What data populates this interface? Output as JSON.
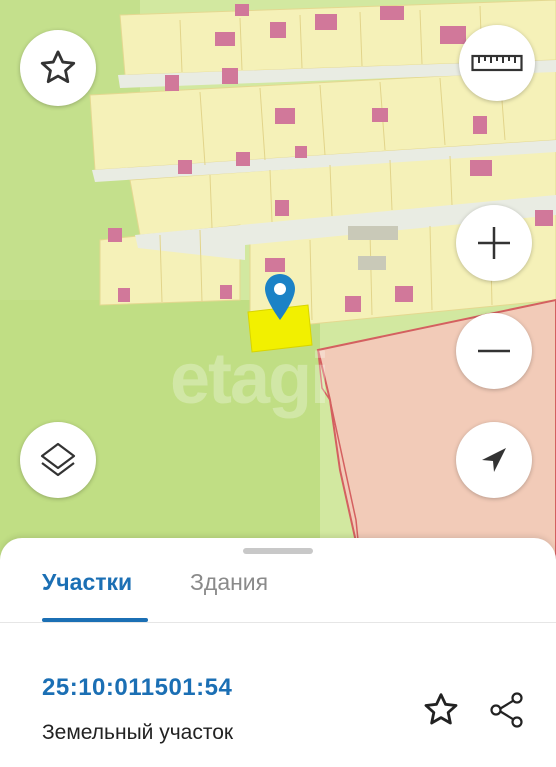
{
  "map": {
    "watermark": "etagi",
    "buttons": {
      "favorite": "star-icon",
      "ruler": "ruler-icon",
      "zoom_in": "plus-icon",
      "zoom_out": "minus-icon",
      "layers": "layers-icon",
      "locate": "navigation-arrow-icon"
    },
    "colors": {
      "land": "#d6eaa0",
      "plot": "#f6f2b6",
      "building": "#d1789a",
      "selected_plot": "#f2f000",
      "marker": "#1b82c6",
      "area_outline": "#d46060"
    }
  },
  "sheet": {
    "tabs": [
      {
        "label": "Участки",
        "active": true
      },
      {
        "label": "Здания",
        "active": false
      }
    ],
    "result": {
      "cadastral_number": "25:10:011501:54",
      "type": "Земельный участок"
    },
    "accent_color": "#1b6fb4"
  }
}
